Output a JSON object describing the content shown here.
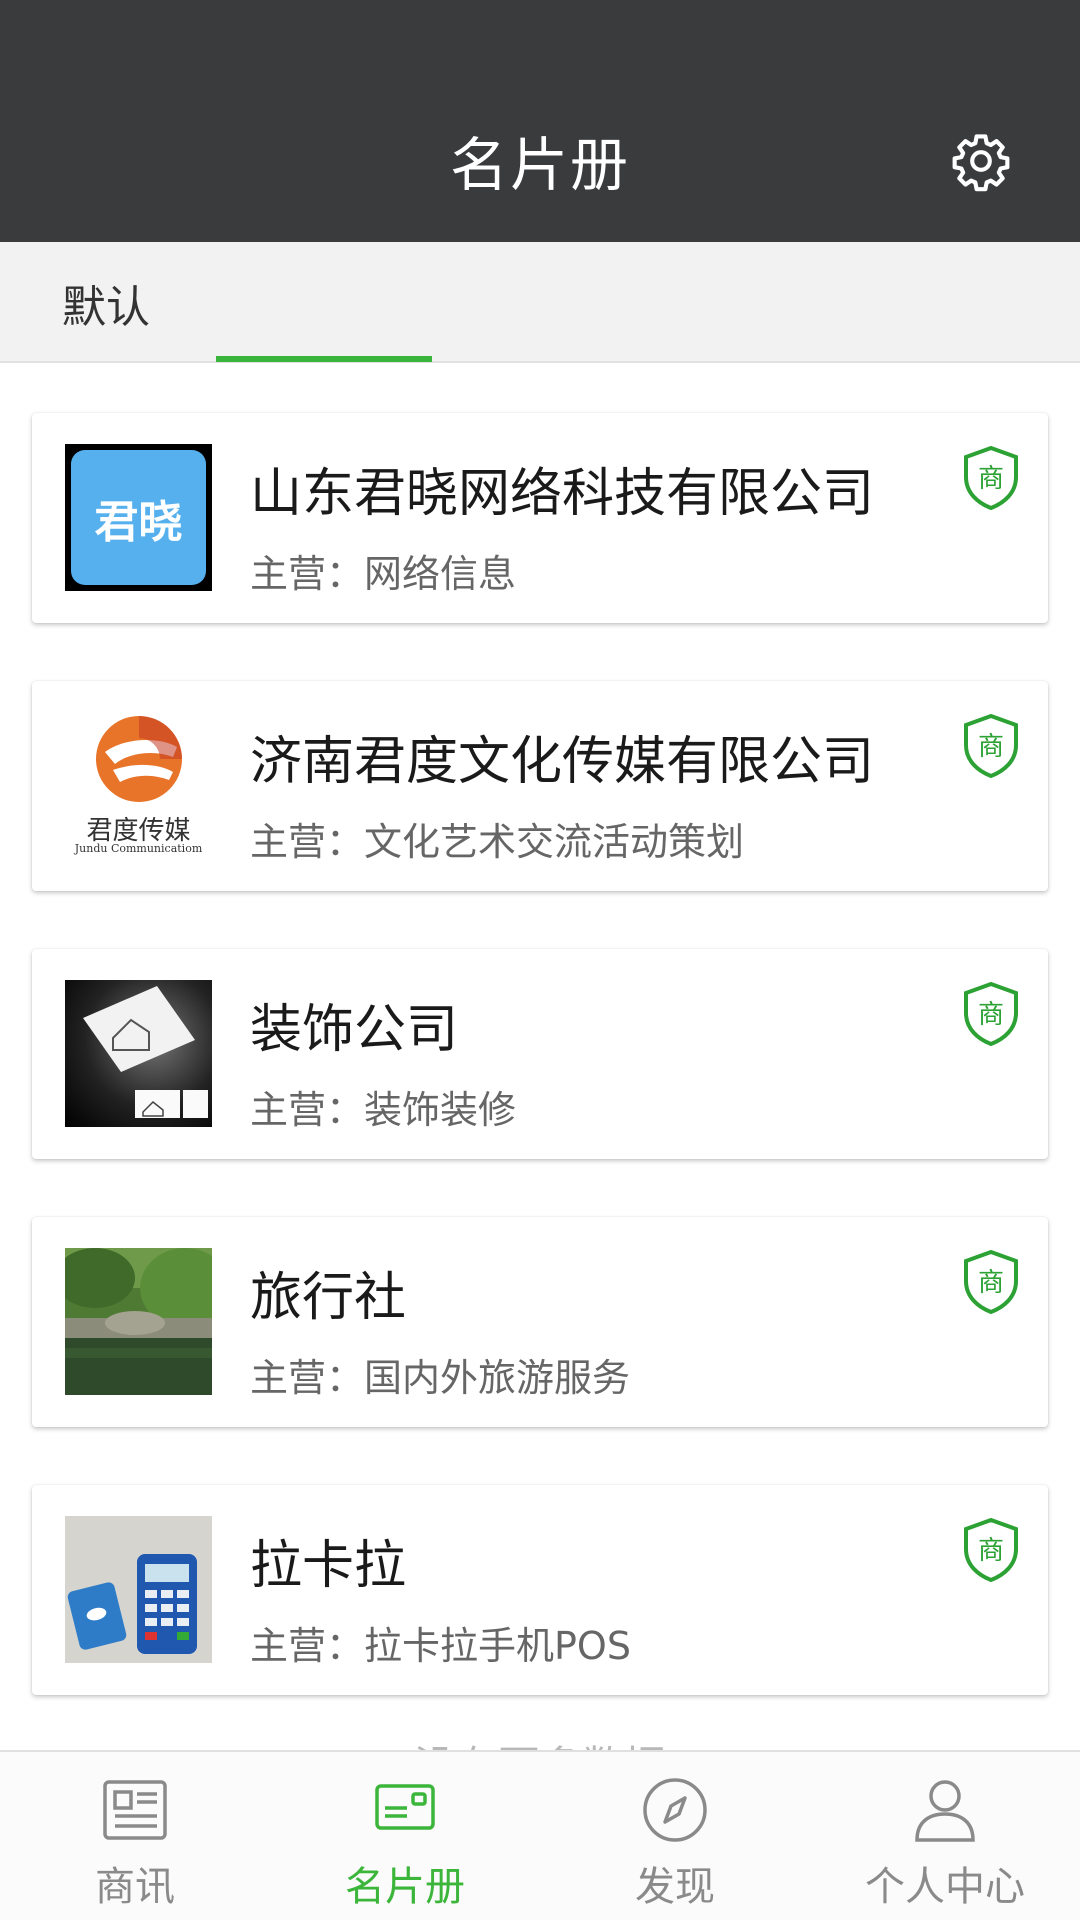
{
  "header": {
    "title": "名片册",
    "settings_icon": "gear-icon"
  },
  "tabs": {
    "default_label": "默认",
    "active_index": 1
  },
  "cards": [
    {
      "name": "山东君晓网络科技有限公司",
      "business": "主营：网络信息",
      "logo_icon": "junxiao-logo",
      "logo_text": "君晓",
      "badge": "商"
    },
    {
      "name": "济南君度文化传媒有限公司",
      "business": "主营：文化艺术交流活动策划",
      "logo_icon": "jundu-logo",
      "logo_text": "君度传媒",
      "logo_subtext": "Jundu Communicatiom",
      "badge": "商"
    },
    {
      "name": "装饰公司",
      "business": "主营：装饰装修",
      "logo_icon": "decoration-photo",
      "badge": "商"
    },
    {
      "name": "旅行社",
      "business": "主营：国内外旅游服务",
      "logo_icon": "garden-photo",
      "badge": "商"
    },
    {
      "name": "拉卡拉",
      "business": "主营：拉卡拉手机POS",
      "logo_icon": "pos-device-photo",
      "badge": "商"
    }
  ],
  "list_footer": "没有更多数据",
  "bottom_nav": [
    {
      "label": "商讯",
      "icon": "newspaper-icon",
      "active": false
    },
    {
      "label": "名片册",
      "icon": "card-icon",
      "active": true
    },
    {
      "label": "发现",
      "icon": "compass-icon",
      "active": false
    },
    {
      "label": "个人中心",
      "icon": "person-icon",
      "active": false
    }
  ],
  "colors": {
    "header_bg": "#393b3d",
    "accent": "#39b53b",
    "tab_bg": "#f1f2f1",
    "badge_green": "#2da234"
  }
}
